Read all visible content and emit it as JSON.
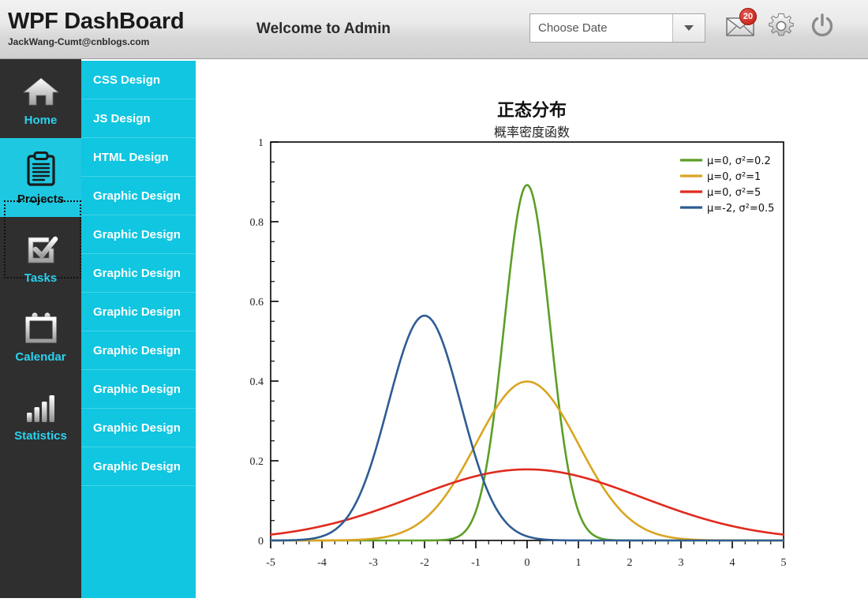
{
  "header": {
    "title": "WPF DashBoard",
    "email": "JackWang-Cumt@cnblogs.com",
    "welcome": "Welcome to Admin",
    "datepicker": {
      "value": "",
      "placeholder": "Choose Date",
      "dropdown_icon": "chevron-down-icon"
    },
    "icons": [
      {
        "name": "mail-icon",
        "badge": "20"
      },
      {
        "name": "gear-icon",
        "badge": ""
      },
      {
        "name": "power-icon",
        "badge": ""
      }
    ]
  },
  "sidebar": {
    "items": [
      {
        "label": "Home",
        "icon": "home-icon",
        "selected": false
      },
      {
        "label": "Projects",
        "icon": "clipboard-icon",
        "selected": true
      },
      {
        "label": "Tasks",
        "icon": "checkbox-icon",
        "selected": false
      },
      {
        "label": "Calendar",
        "icon": "calendar-icon",
        "selected": false
      },
      {
        "label": "Statistics",
        "icon": "bar-chart-icon",
        "selected": false
      }
    ],
    "accent_color": "#2ad2ee",
    "background_color": "#2f2f2f",
    "selected_color": "#1ec8e0"
  },
  "list_panel": {
    "background_color": "#10c6e0",
    "items": [
      {
        "label": "CSS Design"
      },
      {
        "label": "JS Design"
      },
      {
        "label": "HTML Design"
      },
      {
        "label": "Graphic Design"
      },
      {
        "label": "Graphic Design"
      },
      {
        "label": "Graphic Design"
      },
      {
        "label": "Graphic Design"
      },
      {
        "label": "Graphic Design"
      },
      {
        "label": "Graphic Design"
      },
      {
        "label": "Graphic Design"
      },
      {
        "label": "Graphic Design"
      }
    ],
    "drag_handle": "drag-handle-grip"
  },
  "chart_data": {
    "type": "line",
    "title": "正态分布",
    "subtitle": "概率密度函数",
    "xlabel": "",
    "ylabel": "",
    "xlim": [
      -5,
      5
    ],
    "ylim": [
      0,
      1
    ],
    "grid": false,
    "legend_position": "top-right",
    "x_ticks": [
      "-5",
      "-4",
      "-3",
      "-2",
      "-1",
      "0",
      "1",
      "2",
      "3",
      "4",
      "5"
    ],
    "y_ticks": [
      "0",
      "0.2",
      "0.4",
      "0.6",
      "0.8",
      "1"
    ],
    "series": [
      {
        "name": "μ=0, σ²=0.2",
        "color": "#5c9e26",
        "mu": 0,
        "sigma2": 0.2,
        "peak_x": 0,
        "peak_y": 0.892
      },
      {
        "name": "μ=0, σ²=1",
        "color": "#d9a521",
        "mu": 0,
        "sigma2": 1,
        "peak_x": 0,
        "peak_y": 0.399
      },
      {
        "name": "μ=0, σ²=5",
        "color": "#e02a1e",
        "mu": 0,
        "sigma2": 5,
        "peak_x": 0,
        "peak_y": 0.178
      },
      {
        "name": "μ=-2, σ²=0.5",
        "color": "#2e5c94",
        "mu": -2,
        "sigma2": 0.5,
        "peak_x": -2,
        "peak_y": 0.564
      }
    ]
  }
}
